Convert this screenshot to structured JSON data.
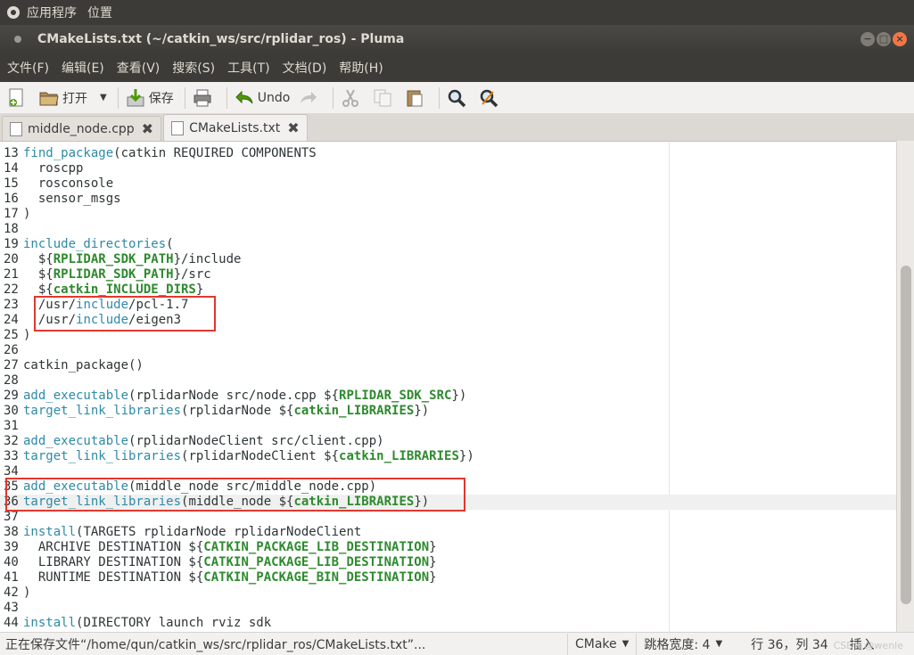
{
  "top_panel": {
    "items": [
      "应用程序",
      "位置"
    ]
  },
  "window": {
    "title": "CMakeLists.txt (~/catkin_ws/src/rplidar_ros) - Pluma",
    "buttons": [
      "−",
      "□",
      "×"
    ]
  },
  "menubar": {
    "items": [
      "文件(F)",
      "编辑(E)",
      "查看(V)",
      "搜索(S)",
      "工具(T)",
      "文档(D)",
      "帮助(H)"
    ]
  },
  "toolbar": {
    "open_label": "打开",
    "save_label": "保存",
    "undo_label": "Undo"
  },
  "tabs": [
    {
      "label": "middle_node.cpp",
      "active": false
    },
    {
      "label": "CMakeLists.txt",
      "active": true
    }
  ],
  "editor": {
    "current_line": "36",
    "lines": [
      {
        "n": "13",
        "t": "find_package(catkin REQUIRED COMPONENTS"
      },
      {
        "n": "14",
        "t": "  roscpp"
      },
      {
        "n": "15",
        "t": "  rosconsole"
      },
      {
        "n": "16",
        "t": "  sensor_msgs"
      },
      {
        "n": "17",
        "t": ")"
      },
      {
        "n": "18",
        "t": ""
      },
      {
        "n": "19",
        "t": "include_directories("
      },
      {
        "n": "20",
        "t": "  ${RPLIDAR_SDK_PATH}/include"
      },
      {
        "n": "21",
        "t": "  ${RPLIDAR_SDK_PATH}/src"
      },
      {
        "n": "22",
        "t": "  ${catkin_INCLUDE_DIRS}"
      },
      {
        "n": "23",
        "t": "  /usr/include/pcl-1.7"
      },
      {
        "n": "24",
        "t": "  /usr/include/eigen3"
      },
      {
        "n": "25",
        "t": ")"
      },
      {
        "n": "26",
        "t": ""
      },
      {
        "n": "27",
        "t": "catkin_package()"
      },
      {
        "n": "28",
        "t": ""
      },
      {
        "n": "29",
        "t": "add_executable(rplidarNode src/node.cpp ${RPLIDAR_SDK_SRC})"
      },
      {
        "n": "30",
        "t": "target_link_libraries(rplidarNode ${catkin_LIBRARIES})"
      },
      {
        "n": "31",
        "t": ""
      },
      {
        "n": "32",
        "t": "add_executable(rplidarNodeClient src/client.cpp)"
      },
      {
        "n": "33",
        "t": "target_link_libraries(rplidarNodeClient ${catkin_LIBRARIES})"
      },
      {
        "n": "34",
        "t": ""
      },
      {
        "n": "35",
        "t": "add_executable(middle_node src/middle_node.cpp)"
      },
      {
        "n": "36",
        "t": "target_link_libraries(middle_node ${catkin_LIBRARIES})"
      },
      {
        "n": "37",
        "t": ""
      },
      {
        "n": "38",
        "t": "install(TARGETS rplidarNode rplidarNodeClient"
      },
      {
        "n": "39",
        "t": "  ARCHIVE DESTINATION ${CATKIN_PACKAGE_LIB_DESTINATION}"
      },
      {
        "n": "40",
        "t": "  LIBRARY DESTINATION ${CATKIN_PACKAGE_LIB_DESTINATION}"
      },
      {
        "n": "41",
        "t": "  RUNTIME DESTINATION ${CATKIN_PACKAGE_BIN_DESTINATION}"
      },
      {
        "n": "42",
        "t": ")"
      },
      {
        "n": "43",
        "t": ""
      },
      {
        "n": "44",
        "t": "install(DIRECTORY launch rviz sdk"
      }
    ]
  },
  "statusbar": {
    "message": "正在保存文件“/home/qun/catkin_ws/src/rplidar_ros/CMakeLists.txt”...",
    "language": "CMake",
    "tab_width": "跳格宽度: 4",
    "position": "行 36，列 34",
    "mode": "插入",
    "watermark": "CSDN @wenle"
  },
  "colors": {
    "keyword": "#2d8aa7",
    "variable": "#2e8a2e",
    "highlight": "#e0382f",
    "panel": "#3c3b37"
  }
}
